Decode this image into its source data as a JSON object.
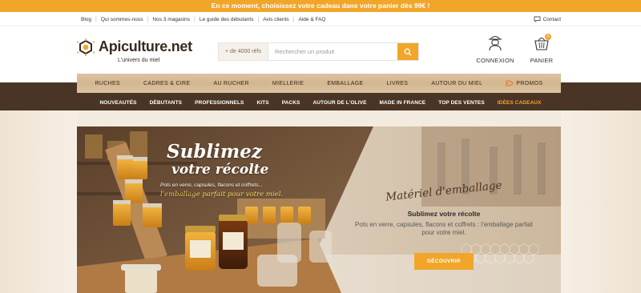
{
  "promo_bar": {
    "text": "En ce moment, choisissez votre cadeau dans votre panier dès 99€ !"
  },
  "utility_nav": {
    "links": [
      "Blog",
      "Qui sommes-nous",
      "Nos 3 magasins",
      "Le guide des débutants",
      "Avis clients",
      "Aide & FAQ"
    ],
    "contact_label": "Contact",
    "contact_icon": "chat-bubble-icon"
  },
  "logo": {
    "text": "Apiculture.net",
    "tagline": "L'univers du miel"
  },
  "search": {
    "refs_label": "+ de 4000 réfs",
    "placeholder": "Rechercher un produit",
    "button_icon": "search-icon"
  },
  "account": {
    "label": "CONNEXION",
    "icon": "beekeeper-icon"
  },
  "cart": {
    "label": "PANIER",
    "icon": "basket-icon",
    "count": "0"
  },
  "main_nav": {
    "items": [
      "RUCHES",
      "CADRES & CIRE",
      "AU RUCHER",
      "MIELLERIE",
      "EMBALLAGE",
      "LIVRES",
      "AUTOUR DU MIEL",
      "PROMOS"
    ],
    "promo_icon": "tag-icon"
  },
  "sub_nav": {
    "items": [
      "NOUVEAUTÉS",
      "DÉBUTANTS",
      "PROFESSIONNELS",
      "KITS",
      "PACKS",
      "AUTOUR DE L'OLIVE",
      "MADE IN FRANCE",
      "TOP DES VENTES",
      "IDÉES CADEAUX"
    ]
  },
  "banner": {
    "title": "Sublimez",
    "subtitle": "votre récolte",
    "line1": "Pots en verre, capsules, flacons et coffrets...",
    "line2": "l'emballage parfait pour votre miel.",
    "script_heading": "Matériel d'emballage",
    "heading": "Sublimez votre récolte",
    "description": "Pots en verre, capsules, flacons et coffrets : l'emballage parfait pour votre miel.",
    "cta_label": "DÉCOUVRIR"
  },
  "colors": {
    "accent": "#f1a62a",
    "dark_brown": "#4a3425",
    "nav_wood": "#d7bc96",
    "cream": "#f3ebe0"
  }
}
